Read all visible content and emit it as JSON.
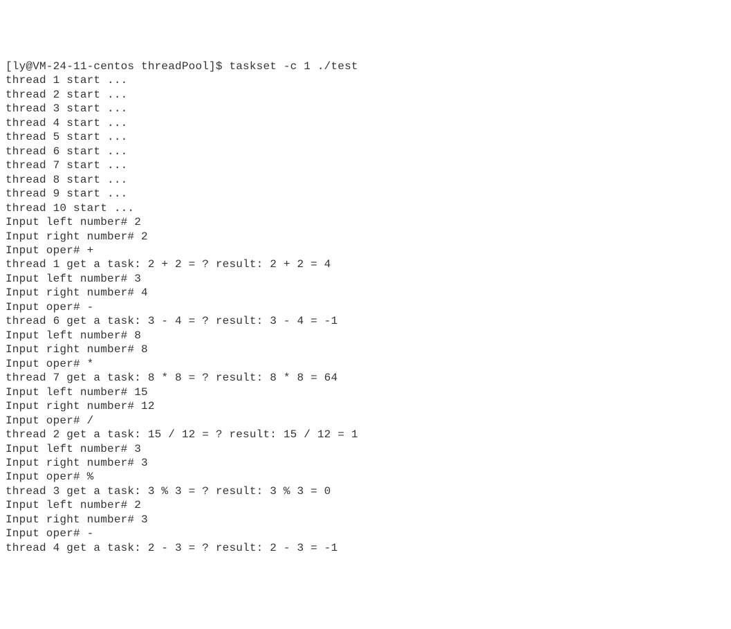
{
  "terminal": {
    "lines": [
      "[ly@VM-24-11-centos threadPool]$ taskset -c 1 ./test",
      "thread 1 start ...",
      "thread 2 start ...",
      "thread 3 start ...",
      "thread 4 start ...",
      "thread 5 start ...",
      "thread 6 start ...",
      "thread 7 start ...",
      "thread 8 start ...",
      "thread 9 start ...",
      "thread 10 start ...",
      "Input left number# 2",
      "Input right number# 2",
      "Input oper# +",
      "thread 1 get a task: 2 + 2 = ? result: 2 + 2 = 4",
      "Input left number# 3",
      "Input right number# 4",
      "Input oper# -",
      "thread 6 get a task: 3 - 4 = ? result: 3 - 4 = -1",
      "Input left number# 8",
      "Input right number# 8",
      "Input oper# *",
      "thread 7 get a task: 8 * 8 = ? result: 8 * 8 = 64",
      "Input left number# 15",
      "Input right number# 12",
      "Input oper# /",
      "thread 2 get a task: 15 / 12 = ? result: 15 / 12 = 1",
      "Input left number# 3",
      "Input right number# 3",
      "Input oper# %",
      "thread 3 get a task: 3 % 3 = ? result: 3 % 3 = 0",
      "Input left number# 2",
      "Input right number# 3",
      "Input oper# -",
      "thread 4 get a task: 2 - 3 = ? result: 2 - 3 = -1"
    ]
  }
}
